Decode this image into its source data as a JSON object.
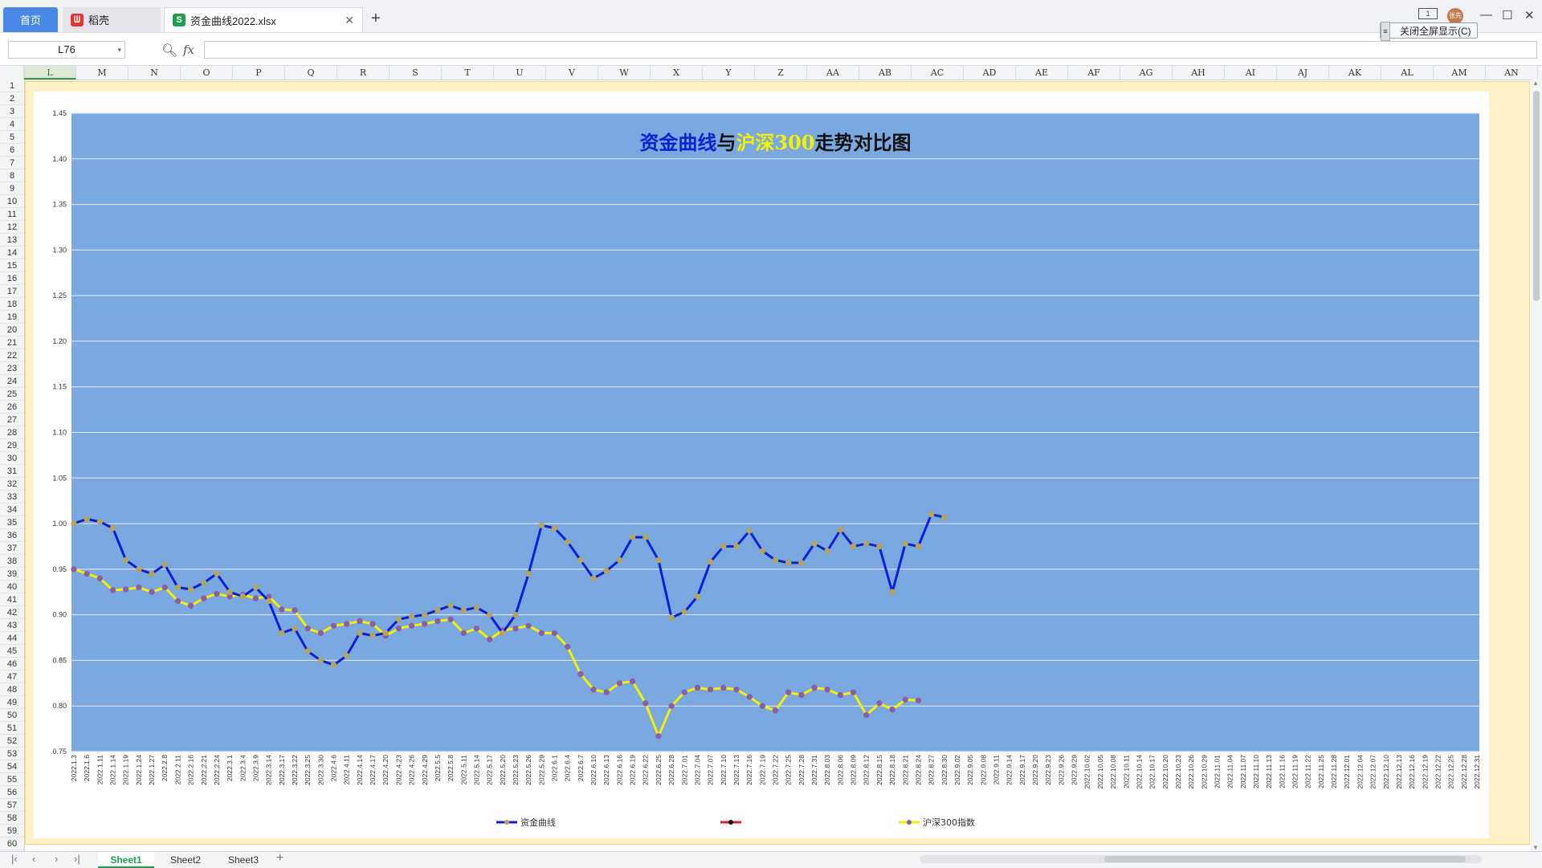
{
  "titlebar": {
    "tabs": [
      {
        "label": "首页",
        "icon": "home"
      },
      {
        "label": "稻壳",
        "icon": "docer-icon"
      },
      {
        "label": "资金曲线2022.xlsx",
        "icon": "spreadsheet-icon"
      }
    ],
    "avatar_text": "张先"
  },
  "formula_bar": {
    "cell_ref": "L76",
    "fx_label": "fx",
    "formula": ""
  },
  "fullscreen_button": "关闭全屏显示(C)",
  "columns": [
    "L",
    "M",
    "N",
    "O",
    "P",
    "Q",
    "R",
    "S",
    "T",
    "U",
    "V",
    "W",
    "X",
    "Y",
    "Z",
    "AA",
    "AB",
    "AC",
    "AD",
    "AE",
    "AF",
    "AG",
    "AH",
    "AI",
    "AJ",
    "AK",
    "AL",
    "AM",
    "AN"
  ],
  "selected_column": "L",
  "rows": [
    1,
    2,
    3,
    4,
    5,
    6,
    7,
    8,
    9,
    10,
    11,
    12,
    13,
    14,
    15,
    16,
    17,
    18,
    19,
    20,
    21,
    22,
    23,
    24,
    25,
    26,
    27,
    28,
    29,
    30,
    31,
    32,
    33,
    34,
    35,
    36,
    37,
    38,
    39,
    40,
    41,
    42,
    43,
    44,
    45,
    46,
    47,
    48,
    49,
    50,
    51,
    52,
    53,
    54,
    55,
    56,
    57,
    58,
    59,
    60
  ],
  "sheets": [
    "Sheet1",
    "Sheet2",
    "Sheet3"
  ],
  "active_sheet": "Sheet1",
  "chart_data": {
    "type": "line",
    "title_parts": [
      {
        "text": "资金曲线",
        "color": "#0a1fd6"
      },
      {
        "text": "与",
        "color": "#111111"
      },
      {
        "text": "沪深300",
        "color": "#f4f000"
      },
      {
        "text": "走势对比图",
        "color": "#111111"
      }
    ],
    "plot_background": "#7aa8e0",
    "ylim": [
      0.75,
      1.45
    ],
    "yticks": [
      0.75,
      0.8,
      0.85,
      0.9,
      0.95,
      1.0,
      1.05,
      1.1,
      1.15,
      1.2,
      1.25,
      1.3,
      1.35,
      1.4,
      1.45
    ],
    "x_categories": [
      "2022.1.3",
      "2022.1.6",
      "2022.1.11",
      "2022.1.14",
      "2022.1.19",
      "2022.1.24",
      "2022.1.27",
      "2022.2.8",
      "2022.2.11",
      "2022.2.16",
      "2022.2.21",
      "2022.2.24",
      "2022.3.1",
      "2022.3.4",
      "2022.3.9",
      "2022.3.14",
      "2022.3.17",
      "2022.3.22",
      "2022.3.25",
      "2022.3.30",
      "2022.4.6",
      "2022.4.11",
      "2022.4.14",
      "2022.4.17",
      "2022.4.20",
      "2022.4.23",
      "2022.4.26",
      "2022.4.29",
      "2022.5.5",
      "2022.5.8",
      "2022.5.11",
      "2022.5.14",
      "2022.5.17",
      "2022.5.20",
      "2022.5.23",
      "2022.5.26",
      "2022.5.29",
      "2022.6.1",
      "2022.6.4",
      "2022.6.7",
      "2022.6.10",
      "2022.6.13",
      "2022.6.16",
      "2022.6.19",
      "2022.6.22",
      "2022.6.25",
      "2022.6.28",
      "2022.7.01",
      "2022.7.04",
      "2022.7.07",
      "2022.7.10",
      "2022.7.13",
      "2022.7.16",
      "2022.7.19",
      "2022.7.22",
      "2022.7.25",
      "2022.7.28",
      "2022.7.31",
      "2022.8.03",
      "2022.8.06",
      "2022.8.09",
      "2022.8.12",
      "2022.8.15",
      "2022.8.18",
      "2022.8.21",
      "2022.8.24",
      "2022.8.27",
      "2022.8.30",
      "2022.9.02",
      "2022.9.05",
      "2022.9.08",
      "2022.9.11",
      "2022.9.14",
      "2022.9.17",
      "2022.9.20",
      "2022.9.23",
      "2022.9.26",
      "2022.9.29",
      "2022.10.02",
      "2022.10.05",
      "2022.10.08",
      "2022.10.11",
      "2022.10.14",
      "2022.10.17",
      "2022.10.20",
      "2022.10.23",
      "2022.10.26",
      "2022.10.29",
      "2022.11.01",
      "2022.11.04",
      "2022.11.07",
      "2022.11.10",
      "2022.11.13",
      "2022.11.16",
      "2022.11.19",
      "2022.11.22",
      "2022.11.25",
      "2022.11.28",
      "2022.12.01",
      "2022.12.04",
      "2022.12.07",
      "2022.12.10",
      "2022.12.13",
      "2022.12.16",
      "2022.12.19",
      "2022.12.22",
      "2022.12.25",
      "2022.12.28",
      "2022.12.31"
    ],
    "series": [
      {
        "name": "资金曲线",
        "line_color": "#0a1fd6",
        "marker_color": "#b7a35a",
        "values": [
          1.0,
          1.005,
          1.002,
          0.995,
          0.96,
          0.95,
          0.945,
          0.955,
          0.93,
          0.928,
          0.935,
          0.945,
          0.925,
          0.92,
          0.93,
          0.915,
          0.88,
          0.885,
          0.86,
          0.85,
          0.845,
          0.855,
          0.88,
          0.877,
          0.88,
          0.895,
          0.898,
          0.9,
          0.905,
          0.91,
          0.905,
          0.908,
          0.9,
          0.88,
          0.9,
          0.945,
          0.998,
          0.995,
          0.98,
          0.96,
          0.94,
          0.948,
          0.96,
          0.985,
          0.985,
          0.96,
          0.897,
          0.903,
          0.92,
          0.958,
          0.975,
          0.975,
          0.992,
          0.97,
          0.96,
          0.957,
          0.957,
          0.978,
          0.97,
          0.993,
          0.975,
          0.978,
          0.975,
          0.925,
          0.978,
          0.975,
          1.01,
          1.007
        ]
      },
      {
        "name": "",
        "line_color": "#e02020",
        "marker_color": "#111111",
        "values": []
      },
      {
        "name": "沪深300指数",
        "line_color": "#f4f000",
        "marker_color": "#8a5fa8",
        "values": [
          0.95,
          0.945,
          0.94,
          0.927,
          0.928,
          0.93,
          0.925,
          0.93,
          0.915,
          0.91,
          0.918,
          0.923,
          0.92,
          0.922,
          0.918,
          0.92,
          0.906,
          0.905,
          0.885,
          0.88,
          0.888,
          0.89,
          0.893,
          0.89,
          0.877,
          0.885,
          0.888,
          0.89,
          0.893,
          0.895,
          0.88,
          0.885,
          0.873,
          0.883,
          0.885,
          0.888,
          0.88,
          0.88,
          0.865,
          0.835,
          0.818,
          0.815,
          0.825,
          0.827,
          0.803,
          0.767,
          0.8,
          0.815,
          0.82,
          0.818,
          0.82,
          0.818,
          0.81,
          0.8,
          0.795,
          0.815,
          0.812,
          0.82,
          0.818,
          0.812,
          0.815,
          0.79,
          0.803,
          0.796,
          0.807,
          0.806
        ]
      }
    ],
    "legend_position": "bottom",
    "grid": true
  }
}
